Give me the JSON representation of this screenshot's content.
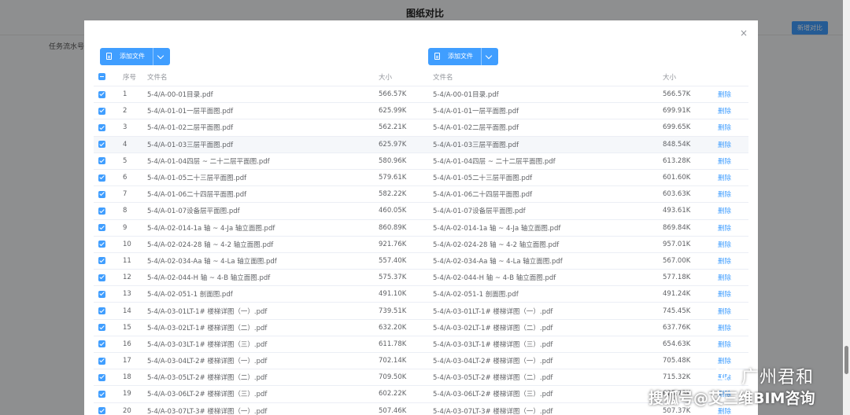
{
  "background": {
    "title": "图纸对比",
    "compare_button": "新增对比",
    "task_label": "任务流水号"
  },
  "modal": {
    "close_icon": "×",
    "left_upload_label": "添加文件",
    "right_upload_label": "添加文件",
    "columns": {
      "index": "序号",
      "left_name": "文件名",
      "left_size": "大小",
      "right_name": "文件名",
      "right_size": "大小"
    },
    "delete_label": "删除",
    "rows": [
      {
        "idx": "1",
        "left_name": "5-4/A-00-01目录.pdf",
        "left_size": "566.57K",
        "right_name": "5-4/A-00-01目录.pdf",
        "right_size": "566.57K"
      },
      {
        "idx": "2",
        "left_name": "5-4/A-01-01一层平面图.pdf",
        "left_size": "625.99K",
        "right_name": "5-4/A-01-01一层平面图.pdf",
        "right_size": "699.91K"
      },
      {
        "idx": "3",
        "left_name": "5-4/A-01-02二层平面图.pdf",
        "left_size": "562.21K",
        "right_name": "5-4/A-01-02二层平面图.pdf",
        "right_size": "699.65K"
      },
      {
        "idx": "4",
        "left_name": "5-4/A-01-03三层平面图.pdf",
        "left_size": "625.97K",
        "right_name": "5-4/A-01-03三层平面图.pdf",
        "right_size": "848.54K"
      },
      {
        "idx": "5",
        "left_name": "5-4/A-01-04四层 ~ 二十二层平面图.pdf",
        "left_size": "580.96K",
        "right_name": "5-4/A-01-04四层 ~ 二十二层平面图.pdf",
        "right_size": "613.28K"
      },
      {
        "idx": "6",
        "left_name": "5-4/A-01-05二十三层平面图.pdf",
        "left_size": "579.61K",
        "right_name": "5-4/A-01-05二十三层平面图.pdf",
        "right_size": "601.60K"
      },
      {
        "idx": "7",
        "left_name": "5-4/A-01-06二十四层平面图.pdf",
        "left_size": "582.22K",
        "right_name": "5-4/A-01-06二十四层平面图.pdf",
        "right_size": "603.63K"
      },
      {
        "idx": "8",
        "left_name": "5-4/A-01-07设备层平面图.pdf",
        "left_size": "460.05K",
        "right_name": "5-4/A-01-07设备层平面图.pdf",
        "right_size": "493.61K"
      },
      {
        "idx": "9",
        "left_name": "5-4/A-02-014-1a 轴 ~ 4-Ja 轴立面图.pdf",
        "left_size": "860.89K",
        "right_name": "5-4/A-02-014-1a 轴 ~ 4-Ja 轴立面图.pdf",
        "right_size": "869.84K"
      },
      {
        "idx": "10",
        "left_name": "5-4/A-02-024-28 轴 ~ 4-2 轴立面图.pdf",
        "left_size": "921.76K",
        "right_name": "5-4/A-02-024-28 轴 ~ 4-2 轴立面图.pdf",
        "right_size": "957.01K"
      },
      {
        "idx": "11",
        "left_name": "5-4/A-02-034-Aa 轴 ~ 4-La 轴立面图.pdf",
        "left_size": "557.40K",
        "right_name": "5-4/A-02-034-Aa 轴 ~ 4-La 轴立面图.pdf",
        "right_size": "567.00K"
      },
      {
        "idx": "12",
        "left_name": "5-4/A-02-044-H 轴 ~ 4-B 轴立面图.pdf",
        "left_size": "575.37K",
        "right_name": "5-4/A-02-044-H 轴 ~ 4-B 轴立面图.pdf",
        "right_size": "577.18K"
      },
      {
        "idx": "13",
        "left_name": "5-4/A-02-051-1 剖面图.pdf",
        "left_size": "491.10K",
        "right_name": "5-4/A-02-051-1 剖面图.pdf",
        "right_size": "491.24K"
      },
      {
        "idx": "14",
        "left_name": "5-4/A-03-01LT-1# 楼梯详图（一）.pdf",
        "left_size": "739.51K",
        "right_name": "5-4/A-03-01LT-1# 楼梯详图（一）.pdf",
        "right_size": "745.45K"
      },
      {
        "idx": "15",
        "left_name": "5-4/A-03-02LT-1# 楼梯详图（二）.pdf",
        "left_size": "632.20K",
        "right_name": "5-4/A-03-02LT-1# 楼梯详图（二）.pdf",
        "right_size": "637.76K"
      },
      {
        "idx": "16",
        "left_name": "5-4/A-03-03LT-1# 楼梯详图（三）.pdf",
        "left_size": "611.78K",
        "right_name": "5-4/A-03-03LT-1# 楼梯详图（三）.pdf",
        "right_size": "654.63K"
      },
      {
        "idx": "17",
        "left_name": "5-4/A-03-04LT-2# 楼梯详图（一）.pdf",
        "left_size": "702.14K",
        "right_name": "5-4/A-03-04LT-2# 楼梯详图（一）.pdf",
        "right_size": "705.48K"
      },
      {
        "idx": "18",
        "left_name": "5-4/A-03-05LT-2# 楼梯详图（二）.pdf",
        "left_size": "709.50K",
        "right_name": "5-4/A-03-05LT-2# 楼梯详图（二）.pdf",
        "right_size": "715.32K"
      },
      {
        "idx": "19",
        "left_name": "5-4/A-03-06LT-2# 楼梯详图（三）.pdf",
        "left_size": "602.22K",
        "right_name": "5-4/A-03-06LT-2# 楼梯详图（三）.pdf",
        "right_size": "625.73K"
      },
      {
        "idx": "20",
        "left_name": "5-4/A-03-07LT-3# 楼梯详图（一）.pdf",
        "left_size": "507.46K",
        "right_name": "5-4/A-03-07LT-3# 楼梯详图（一）.pdf",
        "right_size": "507.37K"
      }
    ]
  },
  "watermark": {
    "line1": "广州君和",
    "line2": "搜狐号@艾三维BIM咨询"
  },
  "colors": {
    "primary": "#409eff",
    "overlay": "rgba(0,0,0,0.42)"
  }
}
